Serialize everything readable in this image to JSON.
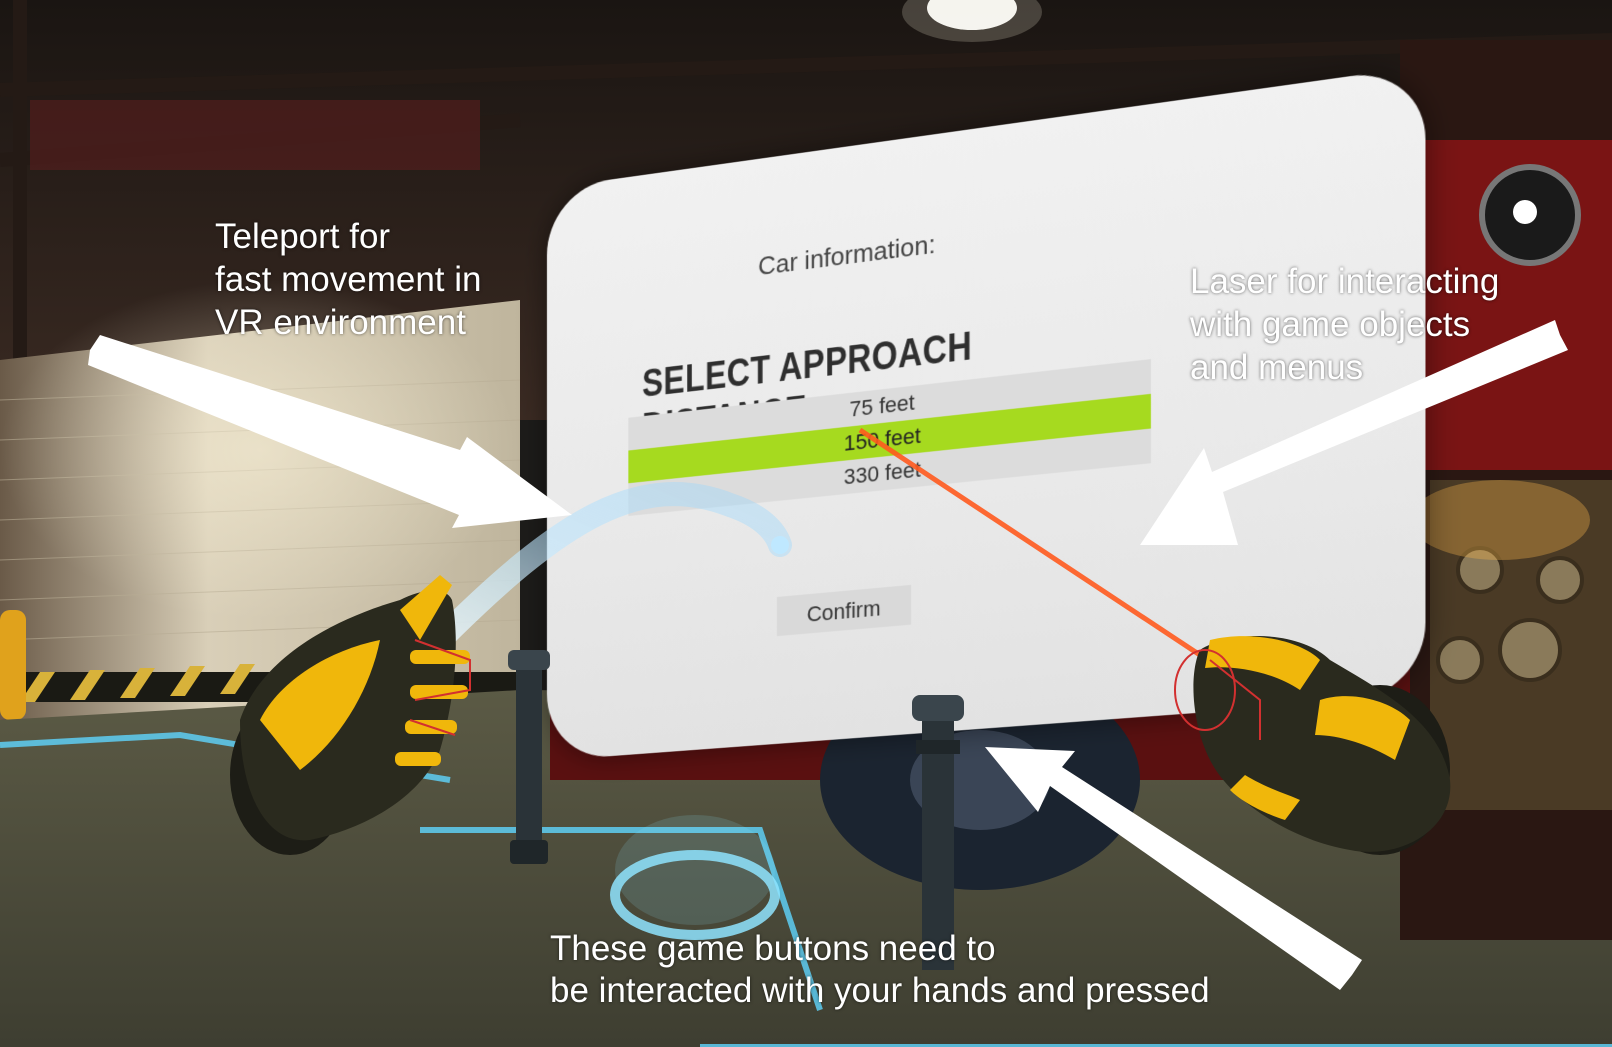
{
  "panel": {
    "header": "Car information:",
    "title": "SELECT APPROACH DISTANCE",
    "options": [
      {
        "label": "75 feet",
        "selected": false
      },
      {
        "label": "150 feet",
        "selected": true
      },
      {
        "label": "330 feet",
        "selected": false
      }
    ],
    "confirm_label": "Confirm",
    "highlight_color": "#a6da1f"
  },
  "annotations": {
    "teleport": [
      "Teleport for",
      "fast movement in",
      "VR environment"
    ],
    "laser": [
      "Laser for interacting",
      "with game objects",
      "and menus"
    ],
    "buttons": [
      "These game buttons need to",
      "be interacted with your hands and pressed"
    ]
  },
  "colors": {
    "teleport_beam": "#8fd4ff",
    "laser": "#ff5a1e",
    "glove": "#f0b70b",
    "floor_line": "#5fd6ff"
  }
}
